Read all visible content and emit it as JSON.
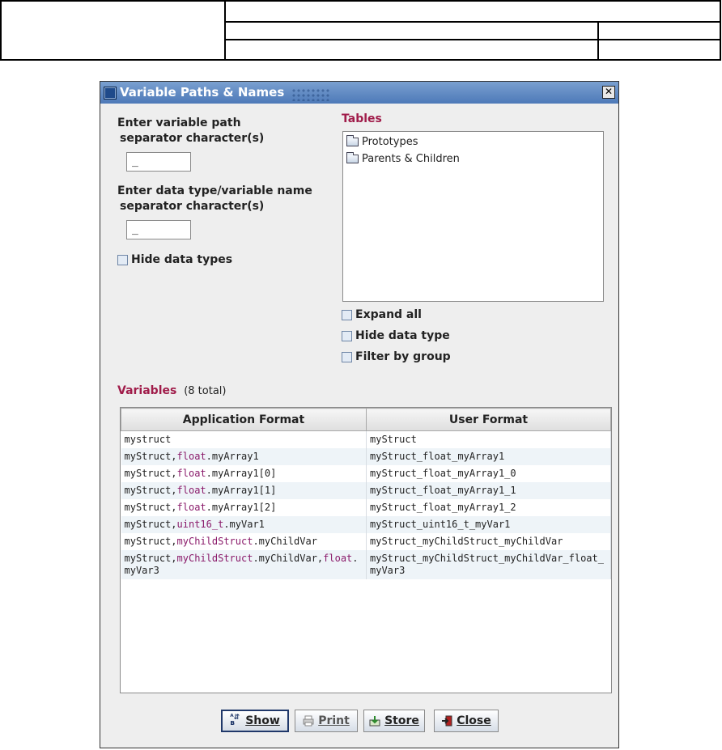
{
  "dialog": {
    "title": "Variable Paths & Names",
    "path_sep_label_1": "Enter variable path",
    "path_sep_label_2": "separator character(s)",
    "path_sep_value": "_",
    "type_sep_label_1": "Enter data type/variable name",
    "type_sep_label_2": "separator character(s)",
    "type_sep_value": "_",
    "hide_data_types": "Hide data types"
  },
  "tables": {
    "heading": "Tables",
    "items": [
      "Prototypes",
      "Parents & Children"
    ],
    "expand_all": "Expand all",
    "hide_data_type": "Hide data type",
    "filter_by_group": "Filter by group"
  },
  "variables": {
    "heading": "Variables",
    "count": "(8 total)",
    "columns": [
      "Application Format",
      "User Format"
    ],
    "rows": [
      {
        "app": [
          "mystruct"
        ],
        "user": "myStruct"
      },
      {
        "app": [
          "myStruct,",
          "float",
          ".myArray1"
        ],
        "user": "myStruct_float_myArray1"
      },
      {
        "app": [
          "myStruct,",
          "float",
          ".myArray1[0]"
        ],
        "user": "myStruct_float_myArray1_0"
      },
      {
        "app": [
          "myStruct,",
          "float",
          ".myArray1[1]"
        ],
        "user": "myStruct_float_myArray1_1"
      },
      {
        "app": [
          "myStruct,",
          "float",
          ".myArray1[2]"
        ],
        "user": "myStruct_float_myArray1_2"
      },
      {
        "app": [
          "myStruct,",
          "uint16_t",
          ".myVar1"
        ],
        "user": "myStruct_uint16_t_myVar1"
      },
      {
        "app": [
          "myStruct,",
          "myChildStruct",
          ".myChildVar"
        ],
        "user": "myStruct_myChildStruct_myChildVar"
      },
      {
        "app": [
          "myStruct,",
          "myChildStruct",
          ".myChildVar,",
          "float",
          ".myVar3"
        ],
        "user": "myStruct_myChildStruct_myChildVar_float_myVar3"
      }
    ]
  },
  "buttons": {
    "show": {
      "label": "Show",
      "icon": "case-swap-icon"
    },
    "print": {
      "label": "Print",
      "icon": "printer-icon"
    },
    "store": {
      "label": "Store",
      "icon": "store-icon"
    },
    "close": {
      "label": "Close",
      "icon": "exit-door-icon"
    }
  },
  "colors": {
    "heading": "#a01c4a",
    "keyword": "#8a1a6a",
    "titlebar": "#4d79b8"
  }
}
